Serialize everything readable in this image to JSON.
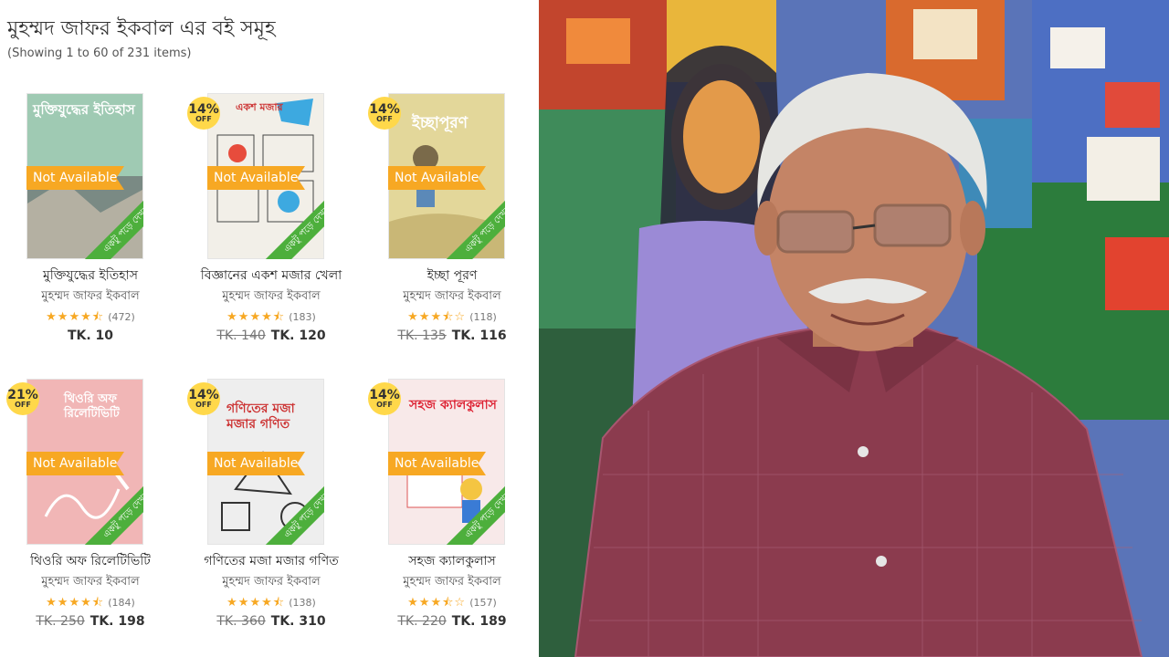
{
  "header": {
    "title": "মুহম্মদ জাফর ইকবাল এর বই সমূহ",
    "count": "(Showing 1 to 60 of 231 items)"
  },
  "labels": {
    "not_available": "Not Available",
    "read_ribbon": "একটু পড়ে দেখুন",
    "off": "OFF"
  },
  "colors": {
    "accent_orange": "#f7a823",
    "ribbon_green": "#4daf3c",
    "badge_yellow": "#ffd84a"
  },
  "books": [
    {
      "title": "মুক্তিযুদ্ধের ইতিহাস",
      "author": "মুহম্মদ জাফর ইকবাল",
      "stars": "★★★★⯪",
      "rating_count": "(472)",
      "discount": "",
      "old_price": "",
      "price": "TK. 10",
      "cover_text": "মুক্তিযুদ্ধের ইতিহাস",
      "cover_bg": "#9fcab3"
    },
    {
      "title": "বিজ্ঞানের একশ মজার খেলা",
      "author": "মুহম্মদ জাফর ইকবাল",
      "stars": "★★★★⯪",
      "rating_count": "(183)",
      "discount": "14%",
      "old_price": "TK. 140",
      "price": "TK. 120",
      "cover_text": "একশ মজার",
      "cover_bg": "#f2efe8"
    },
    {
      "title": "ইচ্ছা পূরণ",
      "author": "মুহম্মদ জাফর ইকবাল",
      "stars": "★★★⯪☆",
      "rating_count": "(118)",
      "discount": "14%",
      "old_price": "TK. 135",
      "price": "TK. 116",
      "cover_text": "ইচ্ছাপূরণ",
      "cover_bg": "#e3d79a"
    },
    {
      "title": "থিওরি অফ রিলেটিভিটি",
      "author": "মুহম্মদ জাফর ইকবাল",
      "stars": "★★★★⯪",
      "rating_count": "(184)",
      "discount": "21%",
      "old_price": "TK. 250",
      "price": "TK. 198",
      "cover_text": "থিওরি অফ রিলেটিভিটি",
      "cover_bg": "#f1b6b6"
    },
    {
      "title": "গণিতের মজা মজার গণিত",
      "author": "মুহম্মদ জাফর ইকবাল",
      "stars": "★★★★⯪",
      "rating_count": "(138)",
      "discount": "14%",
      "old_price": "TK. 360",
      "price": "TK. 310",
      "cover_text": "গণিতের মজা মজার গণিত",
      "cover_bg": "#eeeeee"
    },
    {
      "title": "সহজ ক্যালকুলাস",
      "author": "মুহম্মদ জাফর ইকবাল",
      "stars": "★★★⯪☆",
      "rating_count": "(157)",
      "discount": "14%",
      "old_price": "TK. 220",
      "price": "TK. 189",
      "cover_text": "সহজ ক্যালকুলাস",
      "cover_bg": "#f8e9e9"
    }
  ]
}
